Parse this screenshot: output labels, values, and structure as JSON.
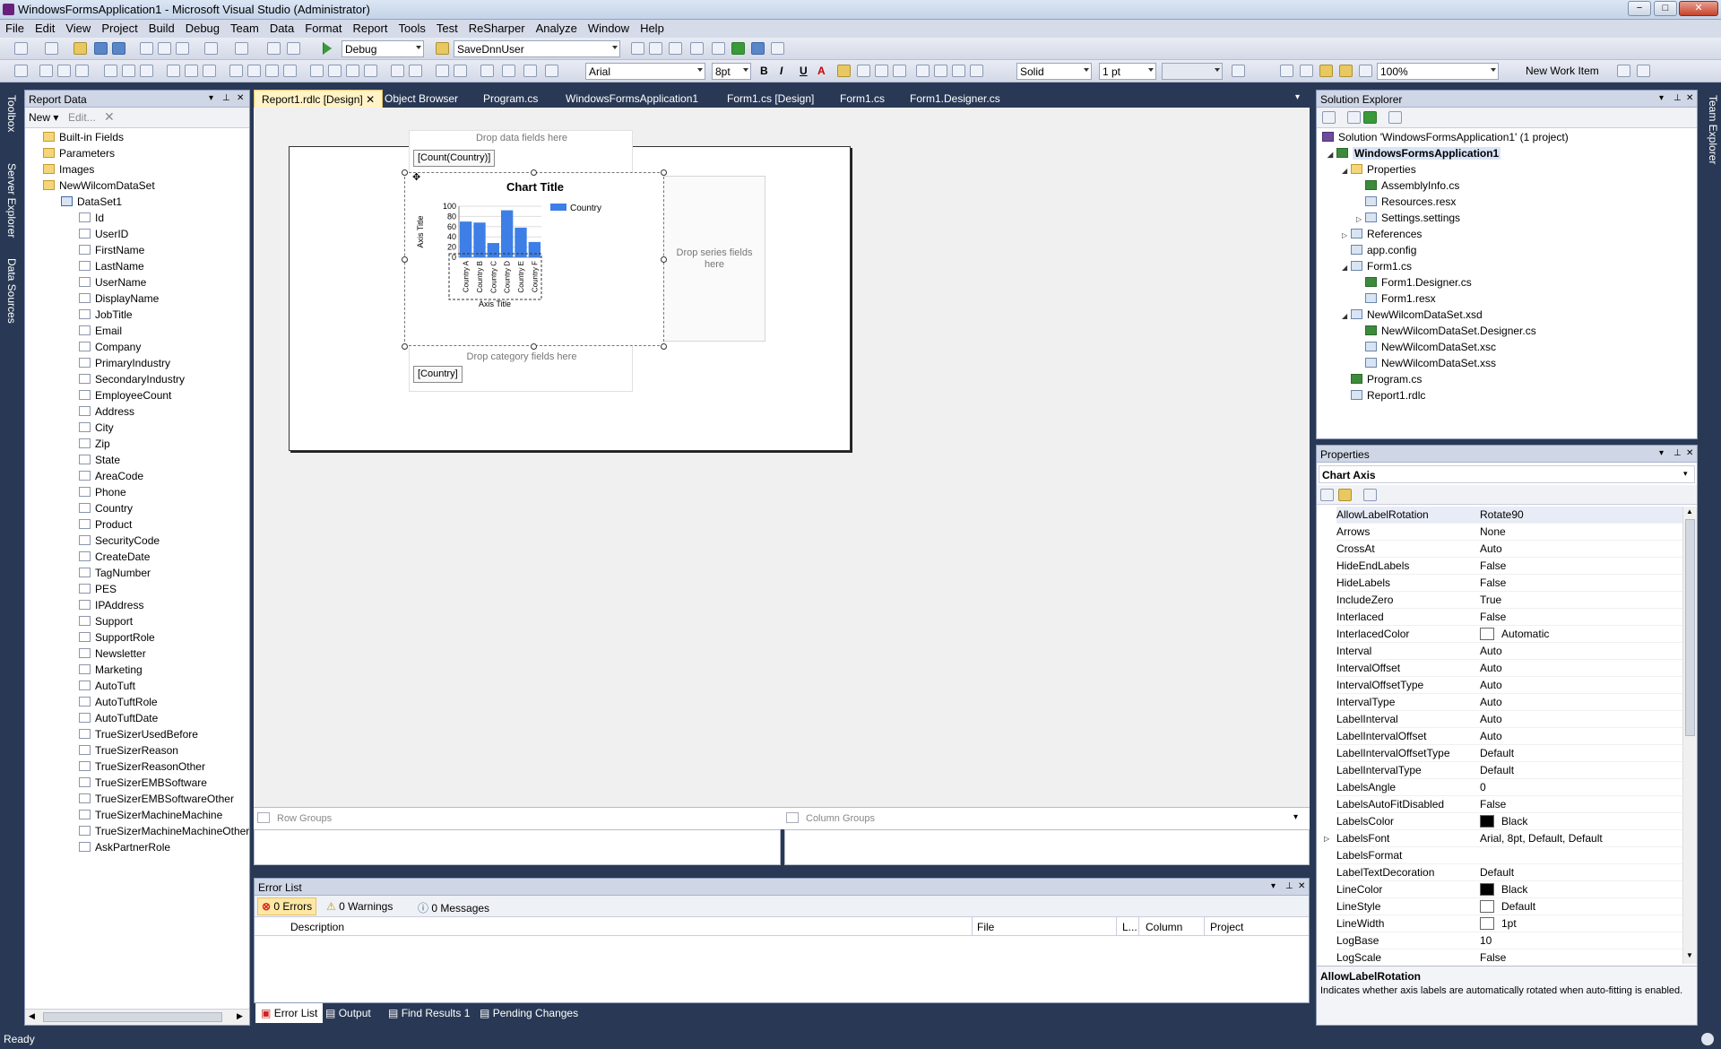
{
  "window": {
    "title": "WindowsFormsApplication1 - Microsoft Visual Studio (Administrator)",
    "buttons": [
      "−",
      "□",
      "✕"
    ]
  },
  "menu": [
    "File",
    "Edit",
    "View",
    "Project",
    "Build",
    "Debug",
    "Team",
    "Data",
    "Format",
    "Report",
    "Tools",
    "Test",
    "ReSharper",
    "Analyze",
    "Window",
    "Help"
  ],
  "toolbar1": {
    "configuration": "Debug",
    "find_combo": "SaveDnnUser"
  },
  "toolbar2": {
    "font": "Arial",
    "size": "8pt",
    "bold": "B",
    "italic": "I",
    "underline": "U",
    "line_style": "Solid",
    "line_width": "1 pt",
    "zoom": "100%",
    "new_work_item": "New Work Item"
  },
  "side_tabs_left": [
    "Toolbox",
    "Server Explorer",
    "Data Sources"
  ],
  "side_tabs_right": [
    "Team Explorer"
  ],
  "report_data": {
    "title": "Report Data",
    "new_label": "New",
    "edit_label": "Edit...",
    "folders": [
      "Built-in Fields",
      "Parameters",
      "Images",
      "NewWilcomDataSet"
    ],
    "dataset": "DataSet1",
    "fields": [
      "Id",
      "UserID",
      "FirstName",
      "LastName",
      "UserName",
      "DisplayName",
      "JobTitle",
      "Email",
      "Company",
      "PrimaryIndustry",
      "SecondaryIndustry",
      "EmployeeCount",
      "Address",
      "City",
      "Zip",
      "State",
      "AreaCode",
      "Phone",
      "Country",
      "Product",
      "SecurityCode",
      "CreateDate",
      "TagNumber",
      "PES",
      "IPAddress",
      "Support",
      "SupportRole",
      "Newsletter",
      "Marketing",
      "AutoTuft",
      "AutoTuftRole",
      "AutoTuftDate",
      "TrueSizerUsedBefore",
      "TrueSizerReason",
      "TrueSizerReasonOther",
      "TrueSizerEMBSoftware",
      "TrueSizerEMBSoftwareOther",
      "TrueSizerMachineMachine",
      "TrueSizerMachineMachineOther",
      "AskPartnerRole"
    ]
  },
  "doc_tabs": [
    "Report1.rdlc [Design]",
    "Object Browser",
    "Program.cs",
    "WindowsFormsApplication1",
    "Form1.cs [Design]",
    "Form1.cs",
    "Form1.Designer.cs"
  ],
  "designer": {
    "drop_data": "Drop data fields here",
    "data_field": "[Count(Country)]",
    "drop_series": "Drop series fields here",
    "drop_category": "Drop category fields here",
    "category_field": "[Country]",
    "row_groups": "Row Groups",
    "column_groups": "Column Groups"
  },
  "chart_data": {
    "type": "bar",
    "title": "Chart Title",
    "xlabel": "Axis Title",
    "ylabel": "Axis Title",
    "categories": [
      "Country A",
      "Country B",
      "Country C",
      "Country D",
      "Country E",
      "Country F"
    ],
    "series": [
      {
        "name": "Country",
        "values": [
          70,
          68,
          28,
          92,
          58,
          30
        ]
      }
    ],
    "ylim": [
      0,
      100
    ],
    "yticks": [
      "100",
      "80",
      "60",
      "40",
      "20",
      "0"
    ],
    "color": "#3d7fe6",
    "legend": "top-right"
  },
  "solution_explorer": {
    "title": "Solution Explorer",
    "items": [
      {
        "label": "Solution 'WindowsFormsApplication1' (1 project)",
        "icon": "solution-icon"
      },
      {
        "label": "WindowsFormsApplication1",
        "icon": "project-icon"
      },
      {
        "label": "Properties",
        "icon": "folder-icon"
      },
      {
        "label": "AssemblyInfo.cs",
        "icon": "cs-file-icon"
      },
      {
        "label": "Resources.resx",
        "icon": "resx-icon"
      },
      {
        "label": "Settings.settings",
        "icon": "settings-icon"
      },
      {
        "label": "References",
        "icon": "references-icon"
      },
      {
        "label": "app.config",
        "icon": "config-icon"
      },
      {
        "label": "Form1.cs",
        "icon": "form-icon"
      },
      {
        "label": "Form1.Designer.cs",
        "icon": "cs-file-icon"
      },
      {
        "label": "Form1.resx",
        "icon": "resx-icon"
      },
      {
        "label": "NewWilcomDataSet.xsd",
        "icon": "xsd-icon"
      },
      {
        "label": "NewWilcomDataSet.Designer.cs",
        "icon": "cs-file-icon"
      },
      {
        "label": "NewWilcomDataSet.xsc",
        "icon": "xml-icon"
      },
      {
        "label": "NewWilcomDataSet.xss",
        "icon": "xml-icon"
      },
      {
        "label": "Program.cs",
        "icon": "cs-file-icon"
      },
      {
        "label": "Report1.rdlc",
        "icon": "report-icon"
      }
    ]
  },
  "properties": {
    "title": "Properties",
    "object": "Chart Axis",
    "rows": [
      {
        "k": "AllowLabelRotation",
        "v": "Rotate90"
      },
      {
        "k": "Arrows",
        "v": "None"
      },
      {
        "k": "CrossAt",
        "v": "Auto"
      },
      {
        "k": "HideEndLabels",
        "v": "False"
      },
      {
        "k": "HideLabels",
        "v": "False"
      },
      {
        "k": "IncludeZero",
        "v": "True"
      },
      {
        "k": "Interlaced",
        "v": "False"
      },
      {
        "k": "InterlacedColor",
        "v": "Automatic",
        "swatch": "#ffffff"
      },
      {
        "k": "Interval",
        "v": "Auto"
      },
      {
        "k": "IntervalOffset",
        "v": "Auto"
      },
      {
        "k": "IntervalOffsetType",
        "v": "Auto"
      },
      {
        "k": "IntervalType",
        "v": "Auto"
      },
      {
        "k": "LabelInterval",
        "v": "Auto"
      },
      {
        "k": "LabelIntervalOffset",
        "v": "Auto"
      },
      {
        "k": "LabelIntervalOffsetType",
        "v": "Default"
      },
      {
        "k": "LabelIntervalType",
        "v": "Default"
      },
      {
        "k": "LabelsAngle",
        "v": "0"
      },
      {
        "k": "LabelsAutoFitDisabled",
        "v": "False"
      },
      {
        "k": "LabelsColor",
        "v": "Black",
        "swatch": "#000000"
      },
      {
        "k": "LabelsFont",
        "v": "Arial, 8pt, Default, Default"
      },
      {
        "k": "LabelsFormat",
        "v": ""
      },
      {
        "k": "LabelTextDecoration",
        "v": "Default"
      },
      {
        "k": "LineColor",
        "v": "Black",
        "swatch": "#000000"
      },
      {
        "k": "LineStyle",
        "v": "Default",
        "swatch": "#ffffff"
      },
      {
        "k": "LineWidth",
        "v": "1pt",
        "swatch": "#ffffff"
      },
      {
        "k": "LogBase",
        "v": "10"
      },
      {
        "k": "LogScale",
        "v": "False"
      }
    ],
    "desc_title": "AllowLabelRotation",
    "desc_text": "Indicates whether axis labels are automatically rotated when auto-fitting is enabled."
  },
  "error_list": {
    "title": "Error List",
    "errors": "0 Errors",
    "warnings": "0 Warnings",
    "messages": "0 Messages",
    "columns": [
      "Description",
      "File",
      "L...",
      "Column",
      "Project"
    ]
  },
  "bottom_tabs": [
    "Error List",
    "Output",
    "Find Results 1",
    "Pending Changes"
  ],
  "status": "Ready"
}
